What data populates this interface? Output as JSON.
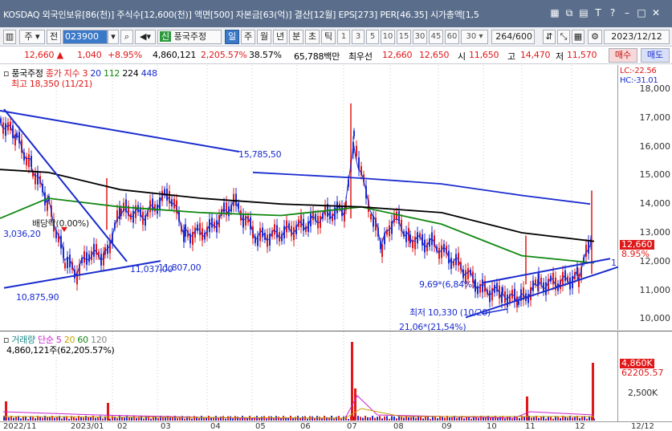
{
  "titlebar": {
    "info": "KOSDAQ 외국인보유[86(천)]  주식수[12,600(천)]  액면[500]  자본금[63(억)]  결산[12월]  EPS[273]  PER[46.35]  시가총액[1,5"
  },
  "toolbar": {
    "code": "023900",
    "market": "주",
    "prev": "전",
    "stock_name": "풍국주정",
    "periods": [
      "일",
      "주",
      "월",
      "년",
      "분",
      "초",
      "틱"
    ],
    "active_period": "일",
    "intervals": [
      "1",
      "3",
      "5",
      "10",
      "15",
      "30",
      "45",
      "60"
    ],
    "interval_select": "30",
    "count": "264",
    "count_total": "/600",
    "date": "2023/12/12"
  },
  "quote": {
    "price": "12,660",
    "change": "1,040",
    "rate": "+8.95%",
    "volume": "4,860,121",
    "vol_rate": "2,205.57%",
    "turnover": "38.57%",
    "amount": "65,788백만",
    "best_label": "최우선",
    "ask": "12,660",
    "bid": "12,650",
    "open_label": "시",
    "open": "11,650",
    "high_label": "고",
    "high": "14,470",
    "low_label": "저",
    "low": "11,570",
    "buy_label": "매수",
    "sell_label": "매도"
  },
  "price_panel": {
    "legend_name": "풍국주정",
    "legend_close": "종가 지수 3",
    "ma": [
      {
        "label": "20",
        "color": "#1a2ccf"
      },
      {
        "label": "112",
        "color": "#118811"
      },
      {
        "label": "224",
        "color": "#000000"
      },
      {
        "label": "448",
        "color": "#1a2ccf"
      }
    ],
    "high_note": "최고 18,350 (11/21)",
    "lc": "LC:-22.56",
    "hc": "HC:-31.01",
    "annotations": {
      "ex_div": "배당락(0.00%)",
      "a1": "3,036,20",
      "a2": "10,875,90",
      "a3": "11,037,00",
      "a4": "11,807,00",
      "a5": "15,785,50",
      "a6": "9,69*(6,84%)",
      "low_note": "최저 10,330 (10/20)",
      "a7": "21,06*(21,54%)",
      "end_mark": "1"
    },
    "current_price": "12,660",
    "current_rate": "8.95%",
    "y_ticks": [
      "18,000",
      "17,000",
      "16,000",
      "15,000",
      "14,000",
      "13,000",
      "12,000",
      "11,000",
      "10,000"
    ]
  },
  "volume_panel": {
    "legend_name": "거래량",
    "legend_simple": "단순",
    "ma": [
      {
        "label": "5",
        "color": "#cc22cc"
      },
      {
        "label": "20",
        "color": "#c8a000"
      },
      {
        "label": "60",
        "color": "#118811"
      },
      {
        "label": "120",
        "color": "#888888"
      }
    ],
    "summary": "4,860,121주(62,205.57%)",
    "tag_volume": "4,860K",
    "tag_rate": "62205.57",
    "y_tick": "2,500K"
  },
  "date_ticks": [
    "2022/11",
    "2023/01",
    "02",
    "03",
    "04",
    "05",
    "06",
    "07",
    "08",
    "09",
    "10",
    "11",
    "12",
    "12/12"
  ]
}
